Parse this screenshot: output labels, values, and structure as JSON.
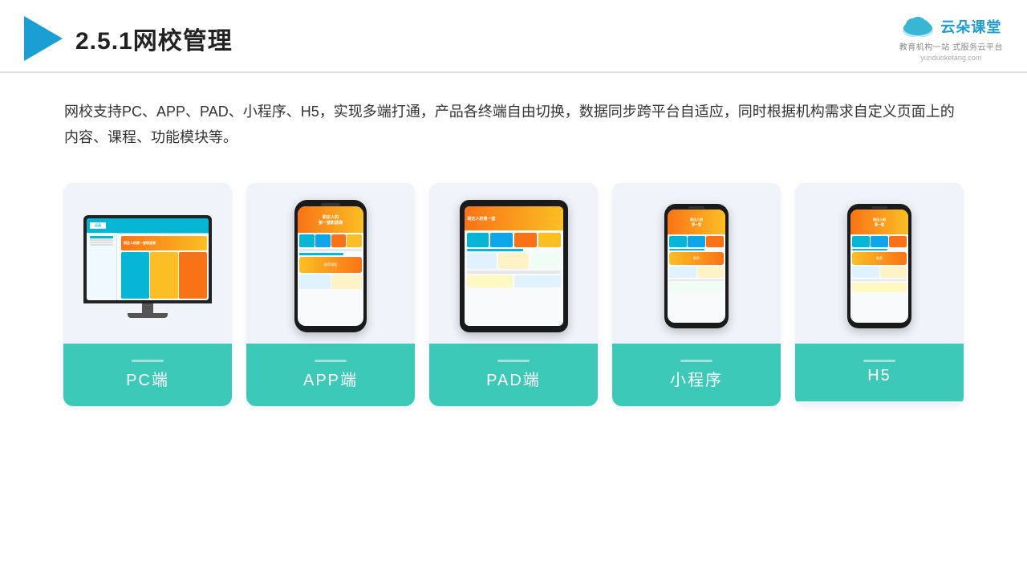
{
  "header": {
    "title": "2.5.1网校管理",
    "brand_name": "云朵课堂",
    "brand_url": "yunduoketang.com",
    "brand_tagline": "教育机构一站\n式服务云平台"
  },
  "description": "网校支持PC、APP、PAD、小程序、H5，实现多端打通，产品各终端自由切换，数据同步跨平台自适应，同时根据机构需求自定义页面上的内容、课程、功能模块等。",
  "cards": [
    {
      "id": "pc",
      "label": "PC端"
    },
    {
      "id": "app",
      "label": "APP端"
    },
    {
      "id": "pad",
      "label": "PAD端"
    },
    {
      "id": "miniprogram",
      "label": "小程序"
    },
    {
      "id": "h5",
      "label": "H5"
    }
  ]
}
